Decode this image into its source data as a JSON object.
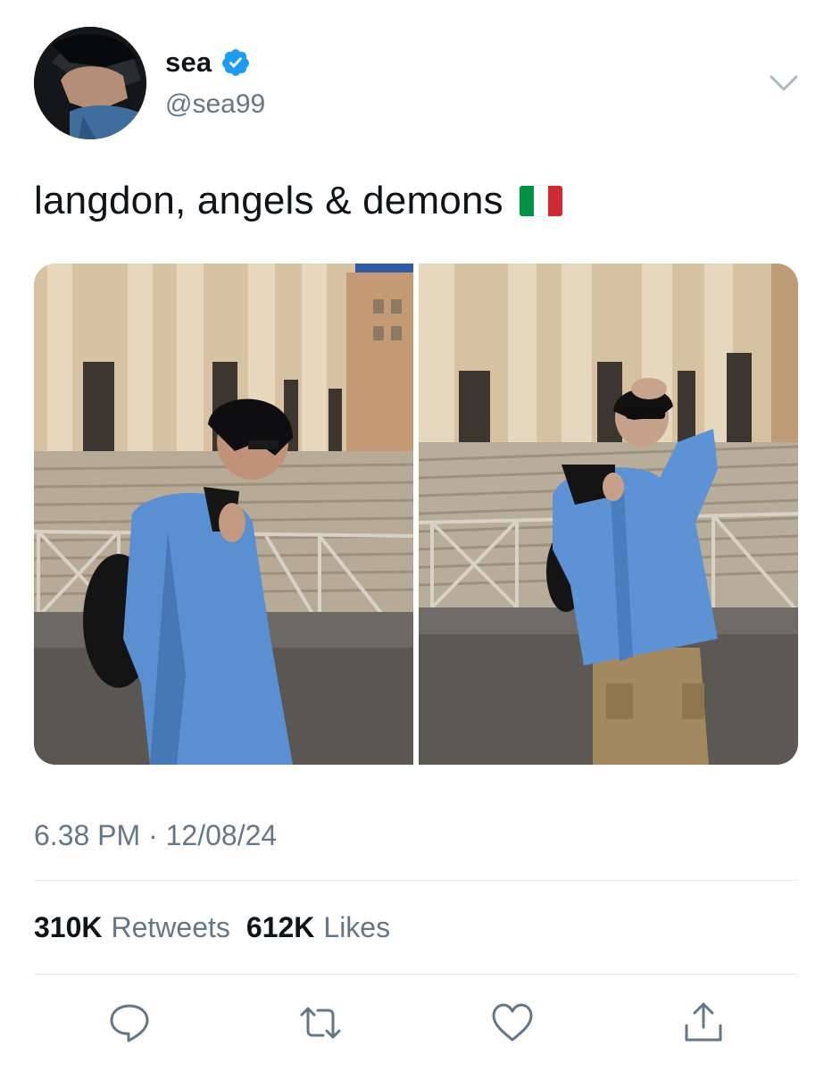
{
  "user": {
    "display_name": "sea",
    "handle": "@sea99",
    "verified": true,
    "verified_color": "#1d9bf0"
  },
  "tweet": {
    "text": "langdon, angels & demons",
    "flag_colors": [
      "#009246",
      "#ffffff",
      "#ce2b37"
    ],
    "timestamp": "6.38 PM · 12/08/24"
  },
  "stats": {
    "retweets_count": "310K",
    "retweets_label": "Retweets",
    "likes_count": "612K",
    "likes_label": "Likes"
  },
  "icons": {
    "menu": "chevron-down-icon",
    "reply": "reply-icon",
    "retweet": "retweet-icon",
    "like": "heart-icon",
    "share": "share-icon"
  },
  "colors": {
    "text_primary": "#0f1419",
    "text_secondary": "#657786",
    "divider": "#e1e8ed",
    "icon": "#657786"
  }
}
